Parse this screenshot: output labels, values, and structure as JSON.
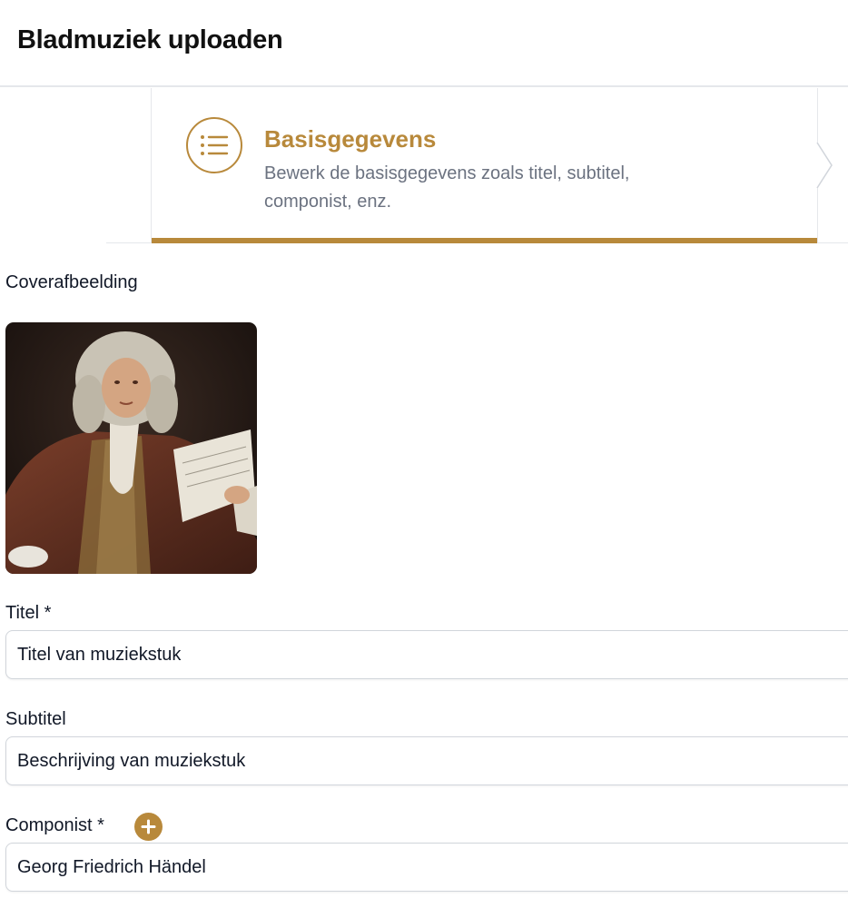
{
  "header": {
    "title": "Bladmuziek uploaden"
  },
  "stepper": {
    "active_step": {
      "icon": "list-icon",
      "title": "Basisgegevens",
      "description": "Bewerk de basisgegevens zoals titel, subtitel, componist, enz."
    }
  },
  "form": {
    "cover": {
      "label": "Coverafbeelding"
    },
    "title": {
      "label": "Titel *",
      "value": "Titel van muziekstuk"
    },
    "subtitle": {
      "label": "Subtitel",
      "value": "Beschrijving van muziekstuk"
    },
    "composer": {
      "label": "Componist *",
      "value": "Georg Friedrich Händel",
      "add_icon": "plus-icon"
    }
  },
  "colors": {
    "accent": "#b8893b",
    "text": "#111827",
    "muted": "#6b7280",
    "border": "#d1d5db"
  }
}
